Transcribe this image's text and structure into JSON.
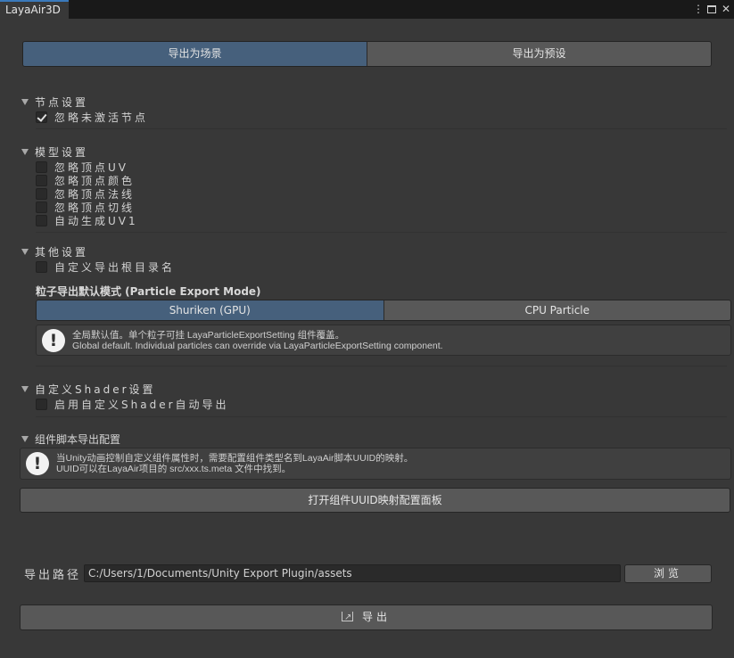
{
  "window": {
    "tab_title": "LayaAir3D"
  },
  "export_mode": {
    "scene_label": "导出为场景",
    "prefab_label": "导出为预设",
    "selected": "scene"
  },
  "node_settings": {
    "title": "节点设置",
    "ignore_inactive": {
      "label": "忽略未激活节点",
      "checked": true
    }
  },
  "model_settings": {
    "title": "模型设置",
    "items": [
      {
        "label": "忽略顶点UV",
        "checked": false
      },
      {
        "label": "忽略顶点颜色",
        "checked": false
      },
      {
        "label": "忽略顶点法线",
        "checked": false
      },
      {
        "label": "忽略顶点切线",
        "checked": false
      },
      {
        "label": "自动生成UV1",
        "checked": false
      }
    ]
  },
  "other_settings": {
    "title": "其他设置",
    "custom_root": {
      "label": "自定义导出根目录名",
      "checked": false
    },
    "particle_mode_label": "粒子导出默认模式 (Particle Export Mode)",
    "particle_options": [
      "Shuriken (GPU)",
      "CPU Particle"
    ],
    "particle_selected": "Shuriken (GPU)",
    "particle_help_line1": "全局默认值。单个粒子可挂 LayaParticleExportSetting 组件覆盖。",
    "particle_help_line2": "Global default. Individual particles can override via LayaParticleExportSetting component."
  },
  "shader_settings": {
    "title": "自定义Shader设置",
    "enable_custom": {
      "label": "启用自定义Shader自动导出",
      "checked": false
    }
  },
  "component_script": {
    "title": "组件脚本导出配置",
    "help_line1": "当Unity动画控制自定义组件属性时，需要配置组件类型名到LayaAir脚本UUID的映射。",
    "help_line2": "UUID可以在LayaAir项目的 src/xxx.ts.meta 文件中找到。",
    "open_panel_label": "打开组件UUID映射配置面板"
  },
  "export_path": {
    "label": "导出路径",
    "value": "C:/Users/1/Documents/Unity Export Plugin/assets",
    "browse_label": "浏览"
  },
  "export_button": {
    "label": "导出"
  }
}
